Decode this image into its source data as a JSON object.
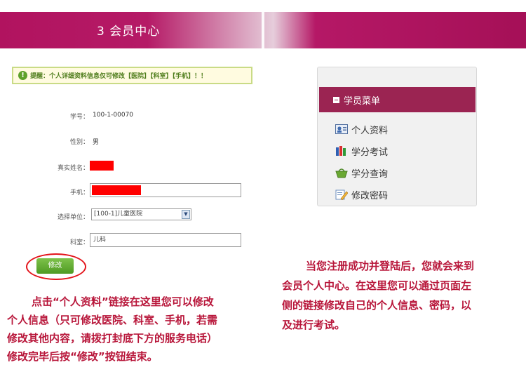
{
  "header": {
    "title": "3 会员中心"
  },
  "notice": {
    "text": "提醒：个人详细资料信息仅可修改【医院】【科室】【手机】！！"
  },
  "form": {
    "student_id_label": "学号：",
    "student_id_value": "100-1-00070",
    "gender_label": "性别：",
    "gender_value": "男",
    "real_name_label": "真实姓名：",
    "phone_label": "手机：",
    "unit_label": "选择单位：",
    "unit_value": "[100-1]儿童医院",
    "dept_label": "科室：",
    "dept_value": "儿科",
    "submit_label": "修改"
  },
  "instructions": {
    "left": [
      "点击“个人资料”链接在这里您可以修改",
      "个人信息（只可修改医院、科室、手机，若需",
      "修改其他内容，请拨打封底下方的服务电话）",
      "修改完毕后按“修改”按钮结束。"
    ],
    "right": [
      "当您注册成功并登陆后，您就会来到",
      "会员个人中心。在这里您可以通过页面左",
      "侧的链接修改自己的个人信息、密码，以",
      "及进行考试。"
    ]
  },
  "menu": {
    "title": "学员菜单",
    "items": [
      {
        "label": "个人资料",
        "icon": "profile-card-icon"
      },
      {
        "label": "学分考试",
        "icon": "books-icon"
      },
      {
        "label": "学分查询",
        "icon": "basket-icon"
      },
      {
        "label": "修改密码",
        "icon": "pencil-icon"
      }
    ]
  },
  "colors": {
    "banner": "#b1135f",
    "menu_header": "#9b2452",
    "note_text": "#b8163a",
    "redaction": "#ff0000"
  }
}
